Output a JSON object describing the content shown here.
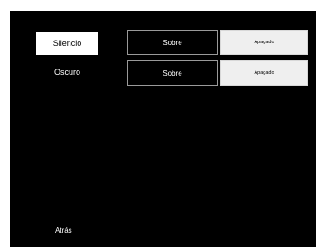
{
  "rows": [
    {
      "label": "Silencio",
      "mode": "Sobre",
      "state": "Apagado",
      "selected": true
    },
    {
      "label": "Oscuro",
      "mode": "Sobre",
      "state": "Apagado",
      "selected": false
    }
  ],
  "back_label": "Atrás",
  "colors": {
    "background": "#000000",
    "selected_bg": "#ffffff",
    "state_bg": "#efefef",
    "border": "#9a9a9a"
  }
}
